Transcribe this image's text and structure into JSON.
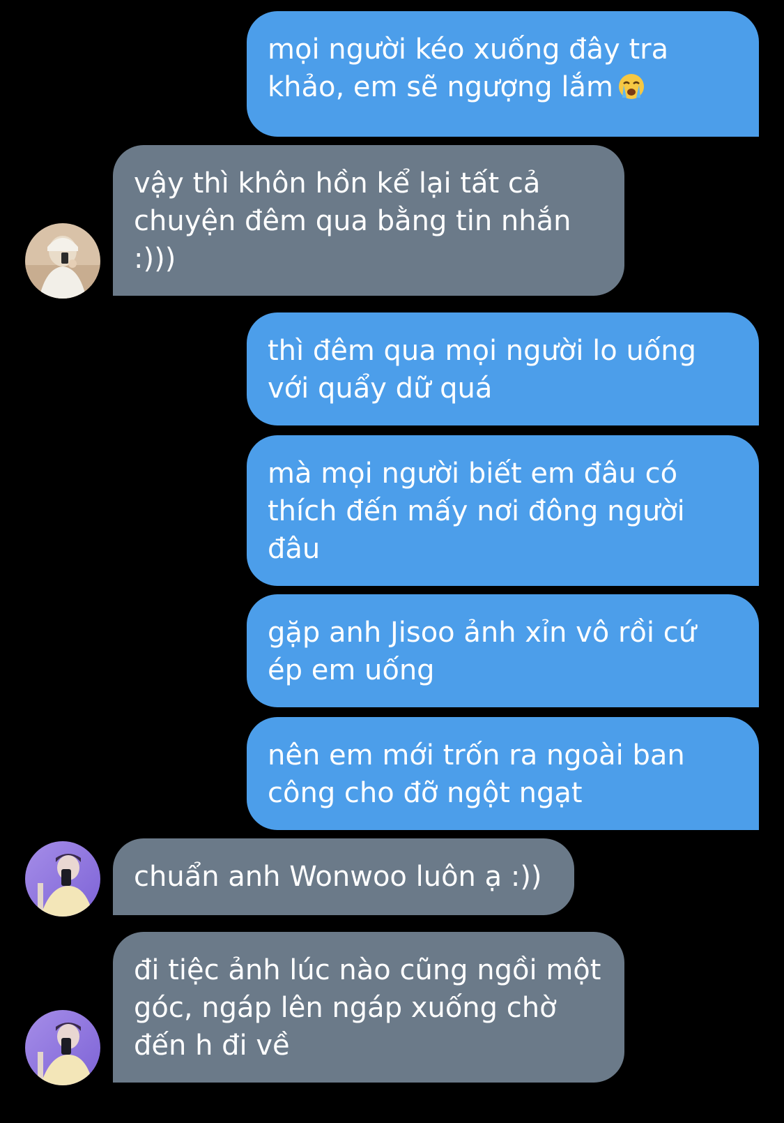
{
  "conversation": {
    "messages": [
      {
        "side": "sent",
        "text": "mọi người kéo xuống đây tra khảo, em sẽ ngượng lắm",
        "emoji": "loudly-crying-face-emoji"
      },
      {
        "side": "received",
        "text": "vậy thì khôn hồn kể lại tất cả chuyện đêm qua bằng tin nhắn :)))"
      },
      {
        "side": "sent",
        "text": "thì đêm qua mọi người lo uống với quẩy dữ quá"
      },
      {
        "side": "sent",
        "text": "mà mọi người biết em đâu có thích đến mấy nơi đông người đâu"
      },
      {
        "side": "sent",
        "text": "gặp anh Jisoo ảnh xỉn vô rồi cứ ép em uống"
      },
      {
        "side": "sent",
        "text": "nên em mới trốn ra ngoài ban công cho đỡ ngột ngạt"
      },
      {
        "side": "received",
        "text": "chuẩn anh Wonwoo luôn ạ :))"
      },
      {
        "side": "received",
        "text": "đi tiệc ảnh lúc nào cũng ngồi một góc, ngáp lên ngáp xuống chờ đến h đi về"
      }
    ]
  },
  "colors": {
    "background": "#000000",
    "sent_bubble": "#4c9eea",
    "received_bubble": "#6b7a89",
    "text": "#ffffff"
  },
  "icons": {
    "avatar_1": "avatar-photo-white-beanie",
    "avatar_2": "avatar-photo-purple-selfie"
  }
}
